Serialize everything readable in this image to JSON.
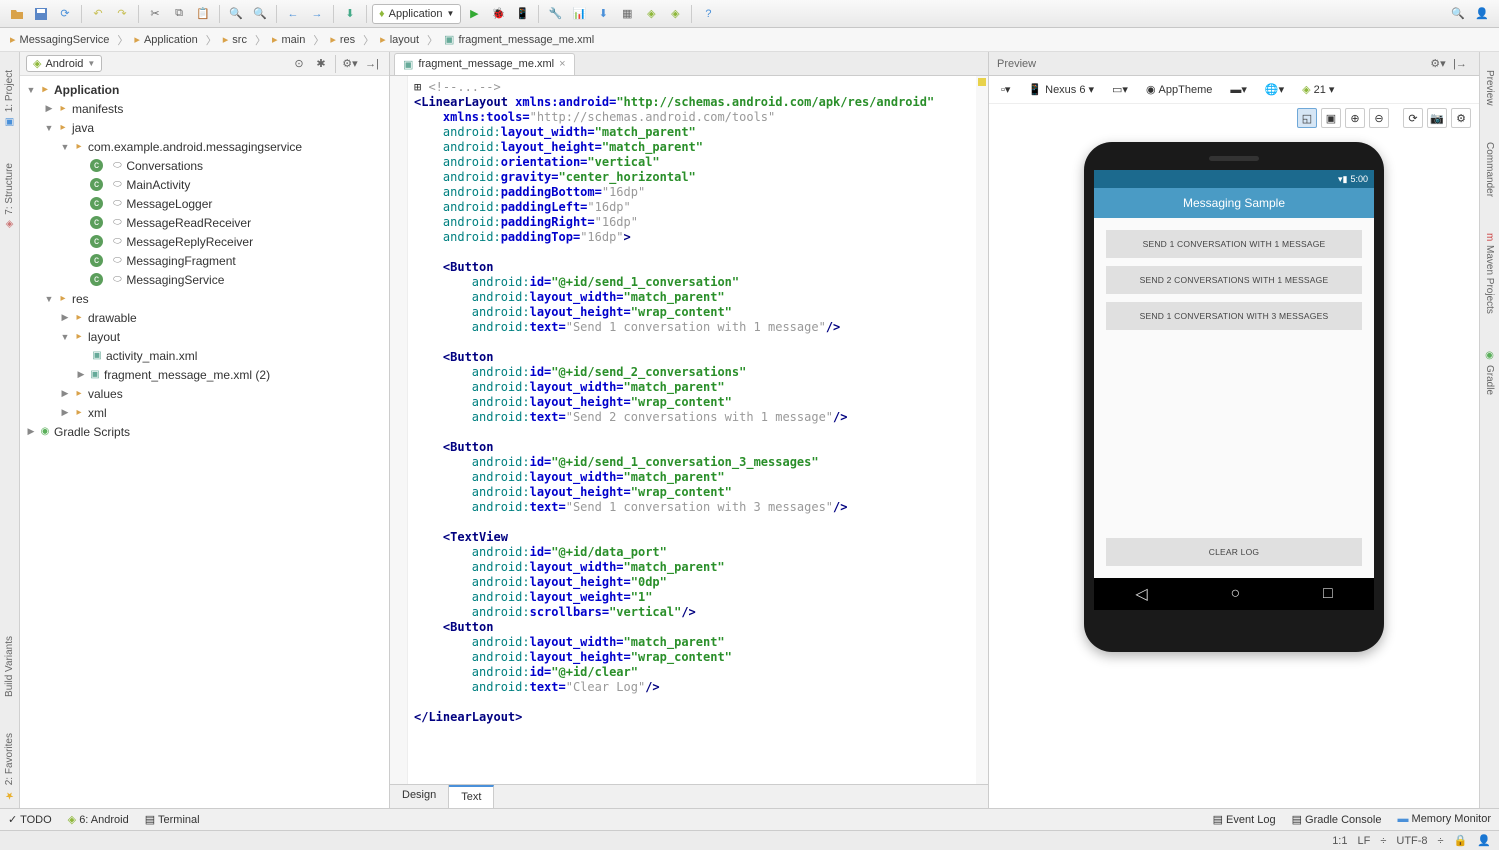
{
  "toolbar": {
    "appselector": "Application"
  },
  "breadcrumb": [
    "MessagingService",
    "Application",
    "src",
    "main",
    "res",
    "layout",
    "fragment_message_me.xml"
  ],
  "sidebar": {
    "selector": "Android",
    "tree": {
      "root": "Application",
      "manifests": "manifests",
      "java": "java",
      "package": "com.example.android.messagingservice",
      "classes": [
        "Conversations",
        "MainActivity",
        "MessageLogger",
        "MessageReadReceiver",
        "MessageReplyReceiver",
        "MessagingFragment",
        "MessagingService"
      ],
      "res": "res",
      "res_children": [
        "drawable",
        "layout",
        "values",
        "xml"
      ],
      "layout_children": [
        "activity_main.xml",
        "fragment_message_me.xml (2)"
      ],
      "gradle": "Gradle Scripts"
    }
  },
  "editor": {
    "tab_name": "fragment_message_me.xml",
    "design_tab": "Design",
    "text_tab": "Text",
    "code": {
      "xmlns_android": "http://schemas.android.com/apk/res/android",
      "xmlns_tools": "http://schemas.android.com/tools",
      "lw": "match_parent",
      "lh": "match_parent",
      "orient": "vertical",
      "grav": "center_horizontal",
      "pb": "16dp",
      "pl": "16dp",
      "pr": "16dp",
      "pt": "16dp",
      "b1_id": "@+id/send_1_conversation",
      "b1_txt": "Send 1 conversation with 1 message",
      "b2_id": "@+id/send_2_conversations",
      "b2_txt": "Send 2 conversations with 1 message",
      "b3_id": "@+id/send_1_conversation_3_messages",
      "b3_txt": "Send 1 conversation with 3 messages",
      "tv_id": "@+id/data_port",
      "tv_h": "0dp",
      "tv_w": "1",
      "tv_sb": "vertical",
      "b4_id": "@+id/clear",
      "b4_txt": "Clear Log",
      "wrap": "wrap_content",
      "match": "match_parent"
    }
  },
  "preview": {
    "title": "Preview",
    "device": "Nexus 6",
    "theme": "AppTheme",
    "api": "21",
    "status_time": "5:00",
    "app_title": "Messaging Sample",
    "buttons": [
      "SEND 1 CONVERSATION WITH 1 MESSAGE",
      "SEND 2 CONVERSATIONS WITH 1 MESSAGE",
      "SEND 1 CONVERSATION WITH 3 MESSAGES"
    ],
    "clear": "CLEAR LOG"
  },
  "left_rail": [
    "1: Project",
    "7: Structure"
  ],
  "left_rail_bottom": [
    "Build Variants",
    "2: Favorites"
  ],
  "right_rail": [
    "Preview",
    "Commander",
    "Maven Projects",
    "Gradle"
  ],
  "status_bar": {
    "todo": "TODO",
    "android": "6: Android",
    "terminal": "Terminal",
    "eventlog": "Event Log",
    "gradle": "Gradle Console",
    "memory": "Memory Monitor"
  },
  "footer": {
    "pos": "1:1",
    "lf": "LF",
    "enc": "UTF-8"
  }
}
